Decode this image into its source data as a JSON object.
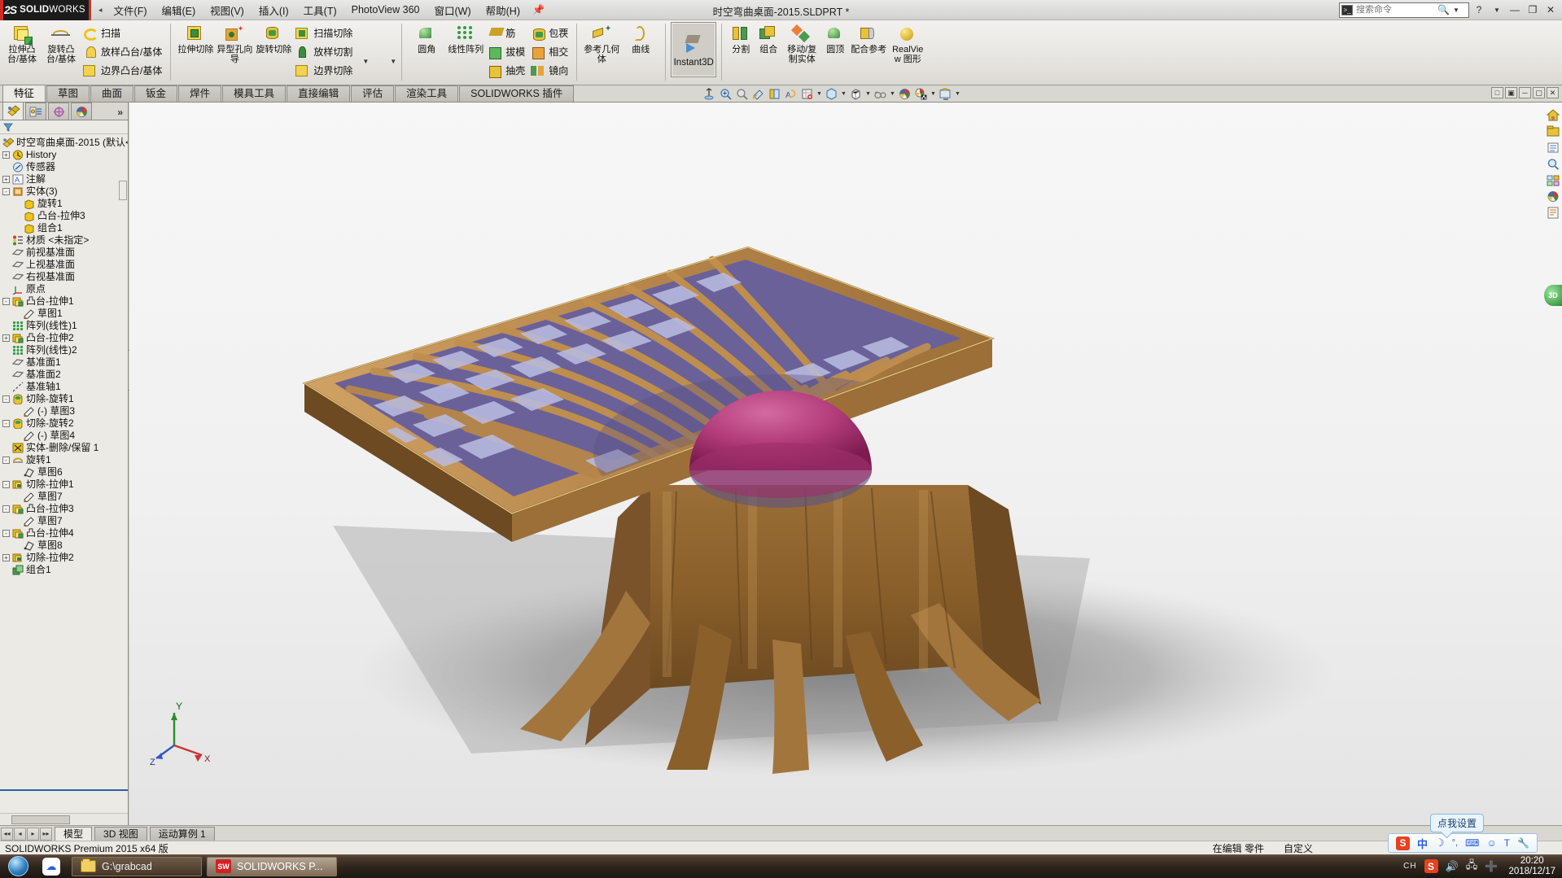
{
  "app": {
    "brand_ds": "2S",
    "brand_name": "SOLIDWORKS",
    "title": "时空弯曲桌面-2015.SLDPRT *"
  },
  "menubar": {
    "items": [
      {
        "label": "文件(F)"
      },
      {
        "label": "编辑(E)"
      },
      {
        "label": "视图(V)"
      },
      {
        "label": "插入(I)"
      },
      {
        "label": "工具(T)"
      },
      {
        "label": "PhotoView 360"
      },
      {
        "label": "窗口(W)"
      },
      {
        "label": "帮助(H)"
      }
    ]
  },
  "search": {
    "placeholder": "搜索命令",
    "value": ""
  },
  "window_controls": {
    "help": "?",
    "minimize": "—",
    "restore": "❐",
    "close": "✕"
  },
  "ribbon": {
    "groups": [
      {
        "name": "boss-group",
        "big": [
          {
            "label": "拉伸凸台/基体",
            "icon": "extruded-boss-icon"
          },
          {
            "label": "旋转凸台/基体",
            "icon": "revolved-boss-icon"
          }
        ],
        "small": [
          {
            "label": "扫描",
            "icon": "swept-boss-icon"
          },
          {
            "label": "放样凸台/基体",
            "icon": "lofted-boss-icon"
          },
          {
            "label": "边界凸台/基体",
            "icon": "boundary-boss-icon"
          }
        ]
      },
      {
        "name": "cut-group",
        "big": [
          {
            "label": "拉伸切除",
            "icon": "extruded-cut-icon"
          },
          {
            "label": "异型孔向导",
            "icon": "hole-wizard-icon"
          },
          {
            "label": "旋转切除",
            "icon": "revolved-cut-icon"
          }
        ],
        "small": [
          {
            "label": "扫描切除",
            "icon": "swept-cut-icon"
          },
          {
            "label": "放样切割",
            "icon": "lofted-cut-icon"
          },
          {
            "label": "边界切除",
            "icon": "boundary-cut-icon"
          }
        ]
      },
      {
        "name": "feature-group",
        "big": [
          {
            "label": "圆角",
            "icon": "fillet-icon"
          },
          {
            "label": "线性阵列",
            "icon": "linear-pattern-icon"
          }
        ],
        "small": [
          {
            "label": "筋",
            "icon": "rib-icon"
          },
          {
            "label": "拔模",
            "icon": "draft-icon"
          },
          {
            "label": "抽壳",
            "icon": "shell-icon"
          }
        ],
        "small2": [
          {
            "label": "包覄",
            "icon": "wrap-icon"
          },
          {
            "label": "相交",
            "icon": "intersect-icon"
          },
          {
            "label": "镜向",
            "icon": "mirror-icon"
          }
        ]
      },
      {
        "name": "reference-group",
        "big": [
          {
            "label": "参考几何体",
            "icon": "reference-geometry-icon"
          },
          {
            "label": "曲线",
            "icon": "curves-icon"
          }
        ]
      },
      {
        "name": "instant3d-group",
        "big": [
          {
            "label": "Instant3D",
            "icon": "instant3d-icon",
            "active": true
          }
        ]
      },
      {
        "name": "body-group",
        "big": [
          {
            "label": "分割",
            "icon": "split-icon"
          },
          {
            "label": "组合",
            "icon": "combine-icon"
          },
          {
            "label": "移动/复制实体",
            "icon": "move-copy-body-icon"
          },
          {
            "label": "圆顶",
            "icon": "dome-icon"
          },
          {
            "label": "配合参考",
            "icon": "mate-reference-icon"
          },
          {
            "label": "RealView 图形",
            "icon": "realview-icon"
          }
        ]
      }
    ]
  },
  "command_tabs": {
    "items": [
      {
        "label": "特征",
        "active": true
      },
      {
        "label": "草图",
        "active": false
      },
      {
        "label": "曲面",
        "active": false
      },
      {
        "label": "钣金",
        "active": false
      },
      {
        "label": "焊件",
        "active": false
      },
      {
        "label": "模具工具",
        "active": false
      },
      {
        "label": "直接编辑",
        "active": false
      },
      {
        "label": "评估",
        "active": false
      },
      {
        "label": "渲染工具",
        "active": false
      },
      {
        "label": "SOLIDWORKS 插件",
        "active": false
      }
    ]
  },
  "view_toolbar": {
    "items": [
      {
        "icon": "zoom-to-fit-icon",
        "dropdown": false
      },
      {
        "icon": "zoom-to-area-icon",
        "dropdown": false
      },
      {
        "icon": "previous-view-icon",
        "dropdown": false
      },
      {
        "icon": "section-view-icon",
        "dropdown": false
      },
      {
        "icon": "view-orientation-icon",
        "dropdown": false
      },
      {
        "icon": "annotation-view-icon",
        "dropdown": false
      },
      {
        "icon": "display-style-icon",
        "dropdown": true
      },
      {
        "icon": "hide-show-items-icon",
        "dropdown": true
      },
      {
        "icon": "edit-appearance-icon",
        "dropdown": true
      },
      {
        "icon": "apply-scene-icon",
        "dropdown": true
      },
      {
        "icon": "view-settings-icon",
        "dropdown": true
      },
      {
        "icon": "viewport-icon",
        "dropdown": true
      }
    ]
  },
  "feature_manager": {
    "tabs": [
      {
        "icon": "feature-tree-icon",
        "active": true
      },
      {
        "icon": "property-manager-icon",
        "active": false
      },
      {
        "icon": "configuration-manager-icon",
        "active": false
      },
      {
        "icon": "display-manager-icon",
        "active": false
      }
    ],
    "more": "»",
    "filter_placeholder": "",
    "root": "时空弯曲桌面-2015  (默认<<",
    "nodes": [
      {
        "label": "History",
        "indent": 1,
        "expand": "+",
        "icon": "history-icon"
      },
      {
        "label": "传感器",
        "indent": 1,
        "expand": "",
        "icon": "sensors-icon"
      },
      {
        "label": "注解",
        "indent": 1,
        "expand": "+",
        "icon": "annotations-icon"
      },
      {
        "label": "实体(3)",
        "indent": 1,
        "expand": "-",
        "icon": "solid-bodies-icon"
      },
      {
        "label": "旋转1",
        "indent": 2,
        "expand": "",
        "icon": "body-icon"
      },
      {
        "label": "凸台-拉伸3",
        "indent": 2,
        "expand": "",
        "icon": "body-icon"
      },
      {
        "label": "组合1",
        "indent": 2,
        "expand": "",
        "icon": "body-icon"
      },
      {
        "label": "材质 <未指定>",
        "indent": 1,
        "expand": "",
        "icon": "material-icon"
      },
      {
        "label": "前视基准面",
        "indent": 1,
        "expand": "",
        "icon": "plane-icon"
      },
      {
        "label": "上视基准面",
        "indent": 1,
        "expand": "",
        "icon": "plane-icon"
      },
      {
        "label": "右视基准面",
        "indent": 1,
        "expand": "",
        "icon": "plane-icon"
      },
      {
        "label": "原点",
        "indent": 1,
        "expand": "",
        "icon": "origin-icon"
      },
      {
        "label": "凸台-拉伸1",
        "indent": 1,
        "expand": "-",
        "icon": "extrude-icon"
      },
      {
        "label": "草图1",
        "indent": 2,
        "expand": "",
        "icon": "sketch-icon"
      },
      {
        "label": "阵列(线性)1",
        "indent": 1,
        "expand": "",
        "icon": "pattern-icon"
      },
      {
        "label": "凸台-拉伸2",
        "indent": 1,
        "expand": "+",
        "icon": "extrude-icon"
      },
      {
        "label": "阵列(线性)2",
        "indent": 1,
        "expand": "",
        "icon": "pattern-icon"
      },
      {
        "label": "基准面1",
        "indent": 1,
        "expand": "",
        "icon": "plane-icon"
      },
      {
        "label": "基准面2",
        "indent": 1,
        "expand": "",
        "icon": "plane-icon"
      },
      {
        "label": "基准轴1",
        "indent": 1,
        "expand": "",
        "icon": "axis-icon"
      },
      {
        "label": "切除-旋转1",
        "indent": 1,
        "expand": "-",
        "icon": "revolve-cut-icon"
      },
      {
        "label": "(-) 草图3",
        "indent": 2,
        "expand": "",
        "icon": "sketch-icon"
      },
      {
        "label": "切除-旋转2",
        "indent": 1,
        "expand": "-",
        "icon": "revolve-cut-icon"
      },
      {
        "label": "(-) 草图4",
        "indent": 2,
        "expand": "",
        "icon": "sketch-icon"
      },
      {
        "label": "实体-删除/保留 1",
        "indent": 1,
        "expand": "",
        "icon": "delete-body-icon"
      },
      {
        "label": "旋转1",
        "indent": 1,
        "expand": "-",
        "icon": "revolve-icon"
      },
      {
        "label": "草图6",
        "indent": 2,
        "expand": "",
        "icon": "sketch3d-icon"
      },
      {
        "label": "切除-拉伸1",
        "indent": 1,
        "expand": "-",
        "icon": "cut-extrude-icon"
      },
      {
        "label": "草图7",
        "indent": 2,
        "expand": "",
        "icon": "sketch-icon"
      },
      {
        "label": "凸台-拉伸3",
        "indent": 1,
        "expand": "-",
        "icon": "extrude-icon"
      },
      {
        "label": "草图7",
        "indent": 2,
        "expand": "",
        "icon": "sketch-icon"
      },
      {
        "label": "凸台-拉伸4",
        "indent": 1,
        "expand": "-",
        "icon": "extrude-icon"
      },
      {
        "label": "草图8",
        "indent": 2,
        "expand": "",
        "icon": "sketch3d-icon"
      },
      {
        "label": "切除-拉伸2",
        "indent": 1,
        "expand": "+",
        "icon": "cut-extrude-icon"
      },
      {
        "label": "组合1",
        "indent": 1,
        "expand": "",
        "icon": "combine-tree-icon"
      }
    ]
  },
  "right_sidebar": {
    "items": [
      {
        "icon": "home-icon"
      },
      {
        "icon": "design-library-icon"
      },
      {
        "icon": "file-explorer-icon"
      },
      {
        "icon": "search-library-icon"
      },
      {
        "icon": "view-palette-icon"
      },
      {
        "icon": "appearances-icon"
      },
      {
        "icon": "custom-properties-icon"
      }
    ],
    "tag_label": "3D"
  },
  "document_tabs": {
    "items": [
      {
        "label": "模型",
        "active": true
      },
      {
        "label": "3D 视图",
        "active": false
      },
      {
        "label": "运动算例 1",
        "active": false
      }
    ]
  },
  "statusbar": {
    "left": "SOLIDWORKS Premium 2015 x64 版",
    "editing": "在编辑 零件",
    "custom": "自定义"
  },
  "ime": {
    "tooltip": "点我设置",
    "items": [
      "S",
      "中",
      "☽",
      "°,",
      "⌨",
      "☺",
      "T",
      "🔧"
    ]
  },
  "taskbar": {
    "items": [
      {
        "label": "G:\\grabcad",
        "icon": "folder-icon",
        "active": false
      },
      {
        "label": "SOLIDWORKS P...",
        "icon": "solidworks-icon",
        "active": true
      }
    ],
    "tray": {
      "lang": "CH",
      "ime": "S",
      "volume": "🔊",
      "network": "🖧",
      "update": "➕",
      "time": "20:20",
      "date": "2018/12/17"
    }
  },
  "model": {
    "name": "时空弯曲桌面",
    "axis_labels": {
      "x": "X",
      "y": "Y",
      "z": "Z"
    },
    "colors": {
      "wood": "#8a5f2a",
      "wood_light": "#b5854a",
      "grid_purple": "#6b6299",
      "grid_lavender": "#b9bbe0",
      "sphere": "#a6286a",
      "shadow": "#8c8c8c"
    }
  }
}
